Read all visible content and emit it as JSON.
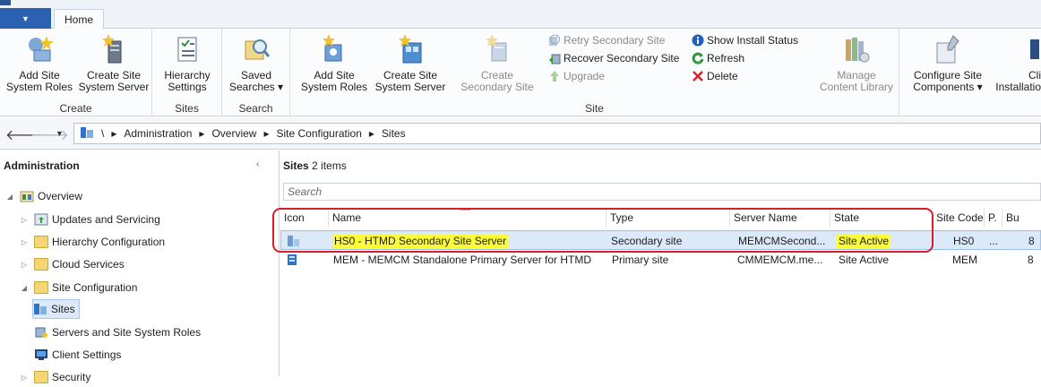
{
  "ribbon_tabs": {
    "file_glyph": "▼",
    "home_label": "Home"
  },
  "ribbon_groups": {
    "create": {
      "label": "Create",
      "buttons": [
        {
          "line1": "Add Site",
          "line2": "System Roles",
          "icon": "add-site-system-roles-icon"
        },
        {
          "line1": "Create Site",
          "line2": "System Server",
          "icon": "create-site-system-server-icon"
        }
      ]
    },
    "sites": {
      "label": "Sites",
      "buttons": [
        {
          "line1": "Hierarchy",
          "line2": "Settings",
          "icon": "hierarchy-settings-icon"
        }
      ]
    },
    "search": {
      "label": "Search",
      "buttons": [
        {
          "line1": "Saved",
          "line2": "Searches ▾",
          "icon": "saved-searches-icon"
        }
      ]
    },
    "site": {
      "label": "Site",
      "buttons": [
        {
          "line1": "Add Site",
          "line2": "System Roles",
          "icon": "add-site-system-roles-icon"
        },
        {
          "line1": "Create Site",
          "line2": "System Server",
          "icon": "create-site-system-server-icon"
        },
        {
          "line1": "Create",
          "line2": "Secondary Site",
          "icon": "create-secondary-site-icon"
        }
      ],
      "small_buttons": [
        {
          "label": "Retry Secondary Site",
          "icon": "retry-icon"
        },
        {
          "label": "Recover Secondary Site",
          "icon": "recover-icon"
        },
        {
          "label": "Upgrade",
          "icon": "upgrade-icon"
        },
        {
          "label": "Show Install Status",
          "icon": "info-icon"
        },
        {
          "label": "Refresh",
          "icon": "refresh-icon"
        },
        {
          "label": "Delete",
          "icon": "delete-icon"
        }
      ],
      "manage": {
        "line1": "Manage",
        "line2": "Content Library",
        "icon": "content-library-icon"
      }
    },
    "more": {
      "buttons": [
        {
          "line1": "Configure Site",
          "line2": "Components ▾",
          "icon": "configure-site-components-icon"
        },
        {
          "line1": "Cli",
          "line2": "Installatio",
          "icon": "client-installation-icon"
        }
      ]
    }
  },
  "breadcrumb": {
    "root_sep": "\\",
    "items": [
      "Administration",
      "Overview",
      "Site Configuration",
      "Sites"
    ],
    "arrow": "▸"
  },
  "nav_pane": {
    "title": "Administration",
    "items": [
      {
        "label": "Overview",
        "icon": "overview-icon",
        "expander": "◢"
      },
      {
        "label": "Updates and Servicing",
        "icon": "updates-icon",
        "expander": "▷"
      },
      {
        "label": "Hierarchy Configuration",
        "icon": "folder-icon",
        "expander": "▷"
      },
      {
        "label": "Cloud Services",
        "icon": "folder-icon",
        "expander": "▷"
      },
      {
        "label": "Site Configuration",
        "icon": "folder-icon",
        "expander": "◢"
      },
      {
        "label": "Sites",
        "icon": "sites-icon",
        "expander": ""
      },
      {
        "label": "Servers and Site System Roles",
        "icon": "servers-icon",
        "expander": ""
      },
      {
        "label": "Client Settings",
        "icon": "client-settings-icon",
        "expander": ""
      },
      {
        "label": "Security",
        "icon": "folder-icon",
        "expander": "▷"
      }
    ]
  },
  "content": {
    "title_bold": "Sites",
    "title_count": "2 items",
    "search_placeholder": "Search",
    "columns": [
      "Icon",
      "Name",
      "Type",
      "Server Name",
      "State",
      "Site Code",
      "P.",
      "Bu"
    ],
    "rows": [
      {
        "icon": "secondary-site-icon",
        "name": "HS0 - HTMD Secondary Site Server",
        "type": "Secondary site",
        "server": "MEMCMSecond...",
        "state": "Site Active",
        "code": "HS0",
        "p": "...",
        "b": "8"
      },
      {
        "icon": "primary-site-icon",
        "name": "MEM - MEMCM Standalone Primary Server for HTMD",
        "type": "Primary site",
        "server": "CMMEMCM.me...",
        "state": "Site Active",
        "code": "MEM",
        "p": "",
        "b": "8"
      }
    ]
  },
  "colors": {
    "highlight": "#fcfb3a",
    "annotation_box": "#d91e2a",
    "selected_row": "#dbe9f9",
    "file_tab": "#2b61b0"
  }
}
